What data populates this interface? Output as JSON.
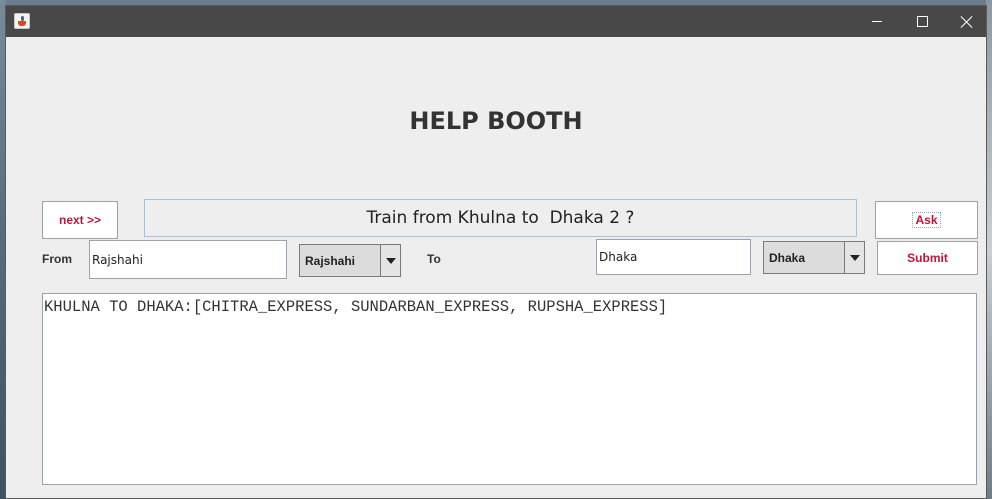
{
  "window": {
    "icon": "java-coffee-cup-icon",
    "controls": {
      "minimize": "minimize-icon",
      "maximize": "maximize-icon",
      "close": "close-icon"
    }
  },
  "heading": "HELP BOOTH",
  "buttons": {
    "next": "next >>",
    "ask": "Ask",
    "submit": "Submit"
  },
  "question": "Train from Khulna to  Dhaka 2 ?",
  "from": {
    "label": "From",
    "value": "Rajshahi",
    "combo_selected": "Rajshahi"
  },
  "to": {
    "label": "To",
    "value": "Dhaka",
    "combo_selected": "Dhaka"
  },
  "result": "KHULNA TO DHAKA:[CHITRA_EXPRESS, SUNDARBAN_EXPRESS, RUPSHA_EXPRESS]",
  "colors": {
    "button_text": "#c0143c",
    "titlebar": "#484848",
    "window_bg": "#eeeeee"
  }
}
